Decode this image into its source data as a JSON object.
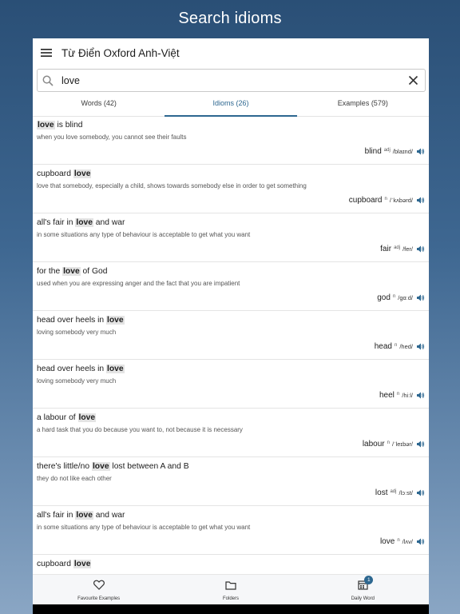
{
  "banner": "Search idioms",
  "app": {
    "title": "Từ Điển Oxford Anh-Việt"
  },
  "search": {
    "value": "love",
    "placeholder": ""
  },
  "tabs": [
    {
      "label": "Words (42)",
      "active": false
    },
    {
      "label": "Idioms (26)",
      "active": true
    },
    {
      "label": "Examples (579)",
      "active": false
    }
  ],
  "results": [
    {
      "pre": "",
      "hl": "love",
      "post": " is blind",
      "def": "when you love somebody, you cannot see their faults",
      "hw": "blind",
      "pos": "adj",
      "pron": "/blaɪnd/"
    },
    {
      "pre": "cupboard ",
      "hl": "love",
      "post": "",
      "def": "love that somebody, especially a child, shows towards somebody else in order to get something",
      "hw": "cupboard",
      "pos": "n",
      "pron": "/ˈkʌbərd/"
    },
    {
      "pre": "all's fair in ",
      "hl": "love",
      "post": " and war",
      "def": "in some situations any type of behaviour is acceptable to get what you want",
      "hw": "fair",
      "pos": "adj",
      "pron": "/fer/"
    },
    {
      "pre": "for the ",
      "hl": "love",
      "post": " of God",
      "def": "used when you are expressing anger and the fact that you are impatient",
      "hw": "god",
      "pos": "n",
      "pron": "/ɡɑːd/"
    },
    {
      "pre": "head over heels in ",
      "hl": "love",
      "post": "",
      "def": "loving somebody very much",
      "hw": "head",
      "pos": "n",
      "pron": "/hed/"
    },
    {
      "pre": "head over heels in ",
      "hl": "love",
      "post": "",
      "def": "loving somebody very much",
      "hw": "heel",
      "pos": "n",
      "pron": "/hiːl/"
    },
    {
      "pre": "a labour of ",
      "hl": "love",
      "post": "",
      "def": "a hard task that you do because you want to, not because it is necessary",
      "hw": "labour",
      "pos": "n",
      "pron": "/ˈleɪbər/"
    },
    {
      "pre": "there's little/no ",
      "hl": "love",
      "post": " lost between A and B",
      "def": "they do not like each other",
      "hw": "lost",
      "pos": "adj",
      "pron": "/lɔːst/"
    },
    {
      "pre": "all's fair in ",
      "hl": "love",
      "post": " and war",
      "def": "in some situations any type of behaviour is acceptable to get what you want",
      "hw": "love",
      "pos": "n",
      "pron": "/lʌv/"
    },
    {
      "pre": "cupboard ",
      "hl": "love",
      "post": "",
      "def": "",
      "hw": "",
      "pos": "",
      "pron": ""
    }
  ],
  "bottom_nav": [
    {
      "label": "Favourite Examples",
      "icon": "heart-icon"
    },
    {
      "label": "Folders",
      "icon": "folder-icon"
    },
    {
      "label": "Daily Word",
      "icon": "calendar-icon",
      "badge": "1"
    }
  ],
  "colors": {
    "accent": "#2d6790",
    "highlight": "#e4e4e4"
  }
}
